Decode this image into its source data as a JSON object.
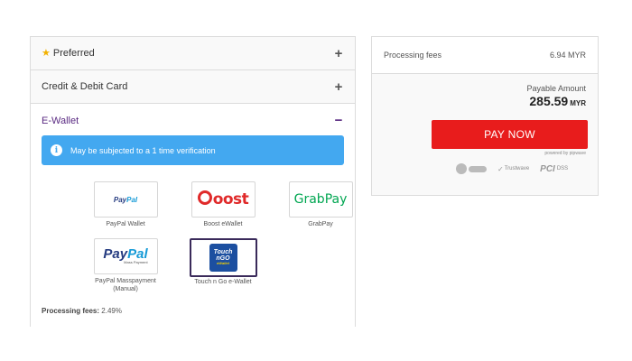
{
  "payment_methods": {
    "preferred": {
      "label": "Preferred",
      "icon": "star-icon",
      "toggle": "+"
    },
    "card": {
      "label": "Credit & Debit Card",
      "toggle": "+"
    },
    "ewallet": {
      "label": "E-Wallet",
      "toggle": "−",
      "info": {
        "icon": "info-icon",
        "glyph": "i",
        "text": "May be subjected to a 1 time verification"
      },
      "wallets": [
        {
          "name": "PayPal Wallet",
          "logo_text_1": "Pay",
          "logo_text_2": "Pal"
        },
        {
          "name": "Boost eWallet",
          "logo_text": "oost"
        },
        {
          "name": "GrabPay",
          "logo_text_1": "Grab",
          "logo_text_2": "Pay"
        },
        {
          "name": "PayPal Masspayment (Manual)",
          "logo_text_1": "Pay",
          "logo_text_2": "Pal",
          "logo_sub": "Mass Payment"
        },
        {
          "name": "Touch n Go e-Wallet",
          "logo_text_1": "Touch",
          "logo_text_2": "nGO",
          "logo_sub": "eWallet",
          "selected": true
        }
      ],
      "processing_fees_label": "Processing fees:",
      "processing_fees_value": "2.49%"
    }
  },
  "summary": {
    "processing_fees_label": "Processing fees",
    "processing_fees_value": "6.94 MYR",
    "payable_label": "Payable Amount",
    "payable_amount": "285.59",
    "payable_currency": "MYR",
    "pay_button": "PAY NOW",
    "powered_by": "powered by pipwave",
    "badges": {
      "trustwave": "Trustwave",
      "pci": "PCI",
      "dss": "DSS"
    }
  },
  "colors": {
    "accent_purple": "#5a2a82",
    "info_blue": "#43a8f0",
    "pay_red": "#e81c1c",
    "star_yellow": "#f2b100"
  }
}
